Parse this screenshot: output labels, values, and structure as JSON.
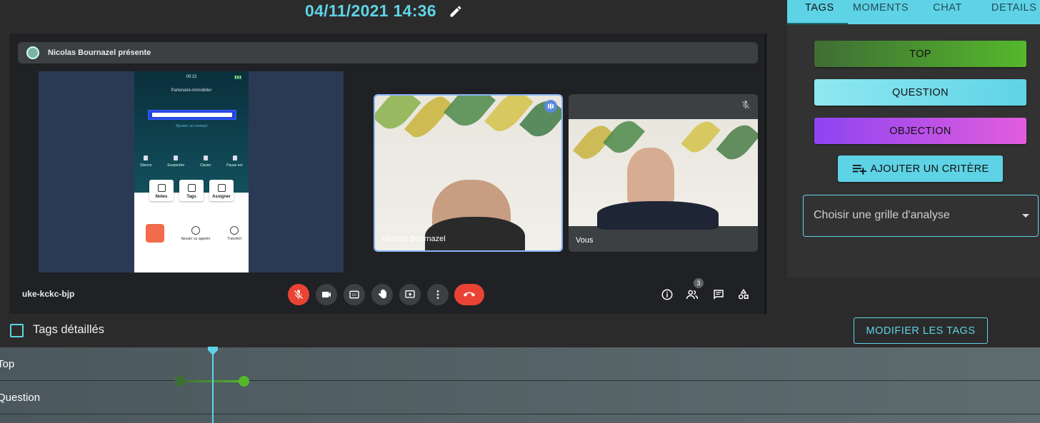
{
  "header": {
    "datetime": "04/11/2021 14:36"
  },
  "meeting": {
    "presenter": "Nicolas Bournazel présente",
    "meeting_code": "uke-kckc-bjp",
    "participants_count": "3",
    "phone": {
      "time": "00:22",
      "carrier": "Partenaire-immobilier",
      "add_contact": "Ajouter un contact",
      "controls": [
        "Silence",
        "Suspendre",
        "Clavier",
        "Pause enr"
      ],
      "buttons": [
        "Notes",
        "Tags",
        "Assigner"
      ],
      "call_actions": [
        "Ajouter ou appeler",
        "Transfert"
      ]
    },
    "tiles": [
      {
        "name": "Nicolas Bournazel"
      },
      {
        "name": "Vous"
      }
    ]
  },
  "sidebar": {
    "tabs": [
      "TAGS",
      "MOMENTS",
      "CHAT",
      "DETAILS"
    ],
    "active_tab": "TAGS",
    "tags": [
      {
        "label": "TOP",
        "color": "#55b82b"
      },
      {
        "label": "QUESTION",
        "color": "#5fd3e6"
      },
      {
        "label": "OBJECTION",
        "color": "#b44fe6"
      }
    ],
    "add_criterion": "AJOUTER UN CRITÈRE",
    "grid_select_placeholder": "Choisir une grille d'analyse"
  },
  "tags_bar": {
    "detailed_label": "Tags détaillés",
    "modify_button": "MODIFIER LES TAGS"
  },
  "timeline": {
    "tracks": [
      "Top",
      "Question"
    ]
  },
  "colors": {
    "accent": "#5fd3e6",
    "danger": "#ea4335"
  }
}
